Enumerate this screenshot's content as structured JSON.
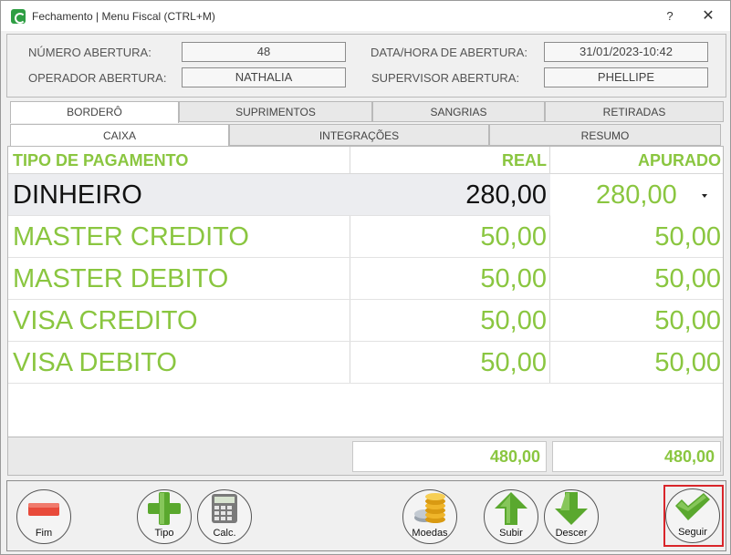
{
  "window": {
    "title": "Fechamento | Menu Fiscal (CTRL+M)",
    "help_label": "?",
    "close_label": "✕"
  },
  "header": {
    "numero_abertura_label": "NÚMERO ABERTURA:",
    "numero_abertura_value": "48",
    "data_hora_label": "DATA/HORA DE ABERTURA:",
    "data_hora_value": "31/01/2023-10:42",
    "operador_label": "OPERADOR ABERTURA:",
    "operador_value": "NATHALIA",
    "supervisor_label": "SUPERVISOR ABERTURA:",
    "supervisor_value": "PHELLIPE"
  },
  "tabs_main": [
    {
      "label": "BORDERÔ",
      "active": true
    },
    {
      "label": "SUPRIMENTOS",
      "active": false
    },
    {
      "label": "SANGRIAS",
      "active": false
    },
    {
      "label": "RETIRADAS",
      "active": false
    }
  ],
  "tabs_sub": [
    {
      "label": "CAIXA",
      "active": true
    },
    {
      "label": "INTEGRAÇÕES",
      "active": false
    },
    {
      "label": "RESUMO",
      "active": false
    }
  ],
  "grid": {
    "columns": {
      "tipo": "TIPO DE PAGAMENTO",
      "real": "REAL",
      "apurado": "APURADO"
    },
    "rows": [
      {
        "tipo": "DINHEIRO",
        "real": "280,00",
        "apurado": "280,00"
      },
      {
        "tipo": "MASTER CREDITO",
        "real": "50,00",
        "apurado": "50,00"
      },
      {
        "tipo": "MASTER DEBITO",
        "real": "50,00",
        "apurado": "50,00"
      },
      {
        "tipo": "VISA CREDITO",
        "real": "50,00",
        "apurado": "50,00"
      },
      {
        "tipo": "VISA DEBITO",
        "real": "50,00",
        "apurado": "50,00"
      }
    ],
    "total_real": "480,00",
    "total_apurado": "480,00"
  },
  "toolbar": {
    "fim": "Fim",
    "tipo": "Tipo",
    "calc": "Calc.",
    "moedas": "Moedas",
    "subir": "Subir",
    "descer": "Descer",
    "seguir": "Seguir"
  },
  "colors": {
    "accent_green": "#8ac640",
    "remove_red": "#e84a3a",
    "highlight_red": "#d9252a"
  }
}
